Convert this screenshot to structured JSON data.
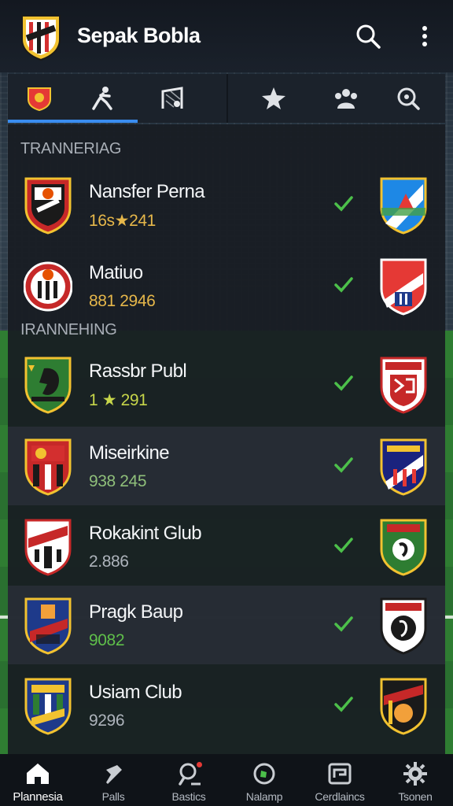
{
  "app": {
    "title": "Sepak Bobla"
  },
  "header_icons": [
    "search-icon",
    "more-vert-icon"
  ],
  "tabs": [
    {
      "icon": "club-crest-icon",
      "active": true
    },
    {
      "icon": "player-running-icon",
      "active": false
    },
    {
      "icon": "goal-net-icon",
      "active": false
    },
    {
      "icon": "gap",
      "active": false
    },
    {
      "icon": "gap",
      "active": false
    },
    {
      "icon": "star-icon",
      "active": false
    },
    {
      "icon": "team-icon",
      "active": false
    },
    {
      "icon": "search-icon",
      "active": false
    }
  ],
  "sections": [
    {
      "label": "TRANNERIAG"
    },
    {
      "label": "IRANNEHING"
    }
  ],
  "rows": [
    {
      "name": "Nansfer Perna",
      "stats": "16s★241",
      "stats_color": "#e6b74a",
      "checked": true
    },
    {
      "name": "Matiuo",
      "stats": "881 2946",
      "stats_color": "#e6b74a",
      "checked": true
    },
    {
      "name": "Rassbr Publ",
      "stats": "1 ★ 291",
      "stats_color": "#c7d64a",
      "checked": true
    },
    {
      "name": "Miseirkine",
      "stats": "938 245",
      "stats_color": "#8fbf7a",
      "checked": true
    },
    {
      "name": "Rokakint Glub",
      "stats": "2.886",
      "stats_color": "#aeb4bc",
      "checked": true
    },
    {
      "name": "Pragk Baup",
      "stats": "9082",
      "stats_color": "#5fbf4a",
      "checked": true
    },
    {
      "name": "Usiam Club",
      "stats": "9296",
      "stats_color": "#aeb4bc",
      "checked": true
    }
  ],
  "bottom_nav": [
    {
      "label": "Plannesia",
      "icon": "home-icon",
      "active": true
    },
    {
      "label": "Palls",
      "icon": "pin-icon",
      "active": false
    },
    {
      "label": "Bastics",
      "icon": "player-search-icon",
      "active": false,
      "badge": true
    },
    {
      "label": "Nalamp",
      "icon": "ball-icon",
      "active": false
    },
    {
      "label": "Cerdlaincs",
      "icon": "cards-icon",
      "active": false
    },
    {
      "label": "Tsonen",
      "icon": "settings-icon",
      "active": false
    }
  ],
  "colors": {
    "accent": "#3a8df0",
    "check": "#4cc04a",
    "panel": "#181c22",
    "appbar": "#131820"
  }
}
